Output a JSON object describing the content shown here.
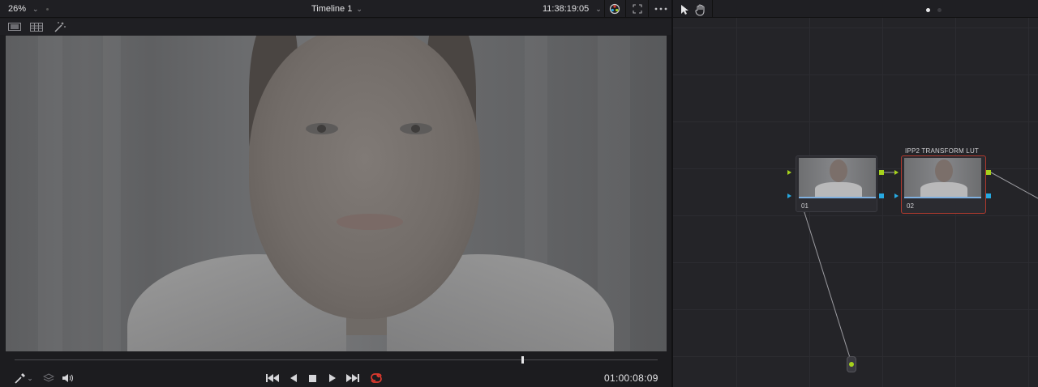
{
  "viewer": {
    "zoom": "26%",
    "timeline_title": "Timeline 1",
    "timecode_top": "11:38:19:05",
    "timecode_bottom": "01:00:08:09",
    "playhead_position": 0.79
  },
  "nodes": {
    "node1": {
      "number": "01"
    },
    "node2": {
      "number": "02",
      "label": "IPP2 TRANSFORM LUT"
    }
  },
  "icons": {
    "zoom_dropdown": "chevron-down-icon",
    "timeline_dropdown": "chevron-down-icon",
    "timecode_dropdown": "chevron-down-icon",
    "color_wheel": "color-wheel-icon",
    "fullscreen": "expand-icon",
    "more": "more-icon",
    "single_view": "single-viewer-icon",
    "split_view": "split-viewer-icon",
    "magic": "magic-wand-icon",
    "picker": "eyedropper-icon",
    "layers": "layers-icon",
    "audio": "speaker-icon",
    "skip_back": "skip-back-icon",
    "step_back": "play-reverse-icon",
    "stop": "stop-icon",
    "play": "play-icon",
    "skip_forward": "skip-forward-icon",
    "loop": "loop-icon",
    "pointer": "pointer-icon",
    "hand": "hand-icon"
  },
  "colors": {
    "accent_red": "#e03a2e",
    "node_selected_border": "#b03a2e",
    "port_green": "#a6d21c",
    "port_blue": "#27a9e1",
    "bar_blue": "#7fb0e0"
  }
}
